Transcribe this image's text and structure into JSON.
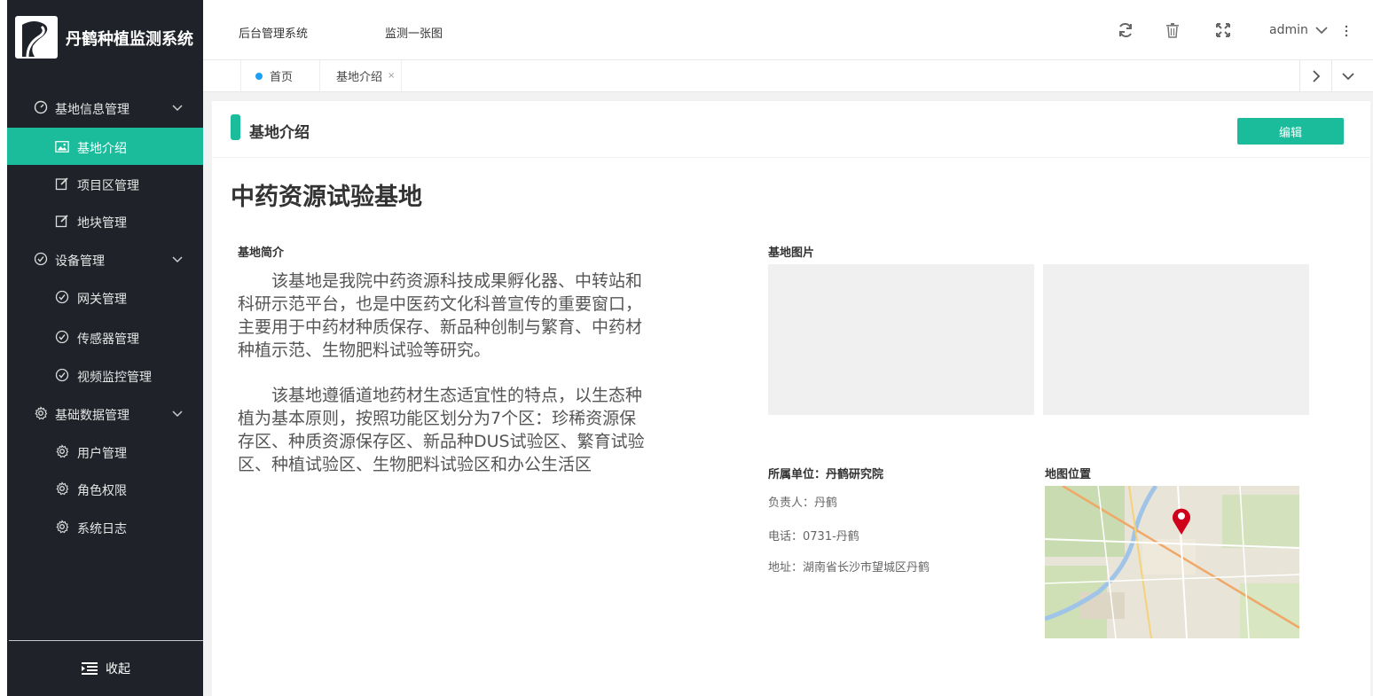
{
  "app": {
    "title": "丹鹤种植监测系统"
  },
  "sidebar": {
    "menu": [
      {
        "label": "基地信息管理",
        "icon": "dashboard-icon",
        "level": 1,
        "expanded": true
      },
      {
        "label": "基地介绍",
        "icon": "image-icon",
        "level": 2,
        "active": true
      },
      {
        "label": "项目区管理",
        "icon": "edit-icon",
        "level": 2
      },
      {
        "label": "地块管理",
        "icon": "edit-icon",
        "level": 2
      },
      {
        "label": "设备管理",
        "icon": "check-circle-icon",
        "level": 1,
        "expanded": true
      },
      {
        "label": "网关管理",
        "icon": "check-circle-icon",
        "level": 2
      },
      {
        "label": "传感器管理",
        "icon": "check-circle-icon",
        "level": 2
      },
      {
        "label": "视频监控管理",
        "icon": "check-circle-icon",
        "level": 2
      },
      {
        "label": "基础数据管理",
        "icon": "gear-icon",
        "level": 1,
        "expanded": true
      },
      {
        "label": "用户管理",
        "icon": "gear-icon",
        "level": 2
      },
      {
        "label": "角色权限",
        "icon": "gear-icon",
        "level": 2
      },
      {
        "label": "系统日志",
        "icon": "gear-icon",
        "level": 2
      }
    ],
    "collapse_label": "收起"
  },
  "topbar": {
    "links": [
      "后台管理系统",
      "监测一张图"
    ],
    "user": "admin",
    "icons": [
      "refresh-icon",
      "trash-icon",
      "fullscreen-icon",
      "more-icon"
    ]
  },
  "tabs": [
    {
      "label": "首页",
      "active_dot": true
    },
    {
      "label": "基地介绍",
      "closable": true,
      "close_glyph": "×"
    }
  ],
  "page": {
    "header_title": "基地介绍",
    "edit_label": "编辑",
    "base_name": "中药资源试验基地",
    "intro_title": "基地简介",
    "intro_paragraphs": [
      "该基地是我院中药资源科技成果孵化器、中转站和科研示范平台，也是中医药文化科普宣传的重要窗口，主要用于中药材种质保存、新品种创制与繁育、中药材种植示范、生物肥料试验等研究。",
      "该基地遵循道地药材生态适宜性的特点，以生态种植为基本原则，按照功能区划分为7个区：珍稀资源保存区、种质资源保存区、新品种DUS试验区、繁育试验区、种植试验区、生物肥料试验区和办公生活区"
    ],
    "images_title": "基地图片",
    "unit_label": "所属单位：丹鹤研究院",
    "contact": "负责人：丹鹤",
    "phone": "电话：0731-丹鹤",
    "address": "地址：湖南省长沙市望城区丹鹤",
    "map_title": "地图位置"
  },
  "colors": {
    "sidebar_bg": "#1f2329",
    "accent": "#1abc9c",
    "tab_dot": "#1e9ff2",
    "map_pin": "#d0021b"
  }
}
